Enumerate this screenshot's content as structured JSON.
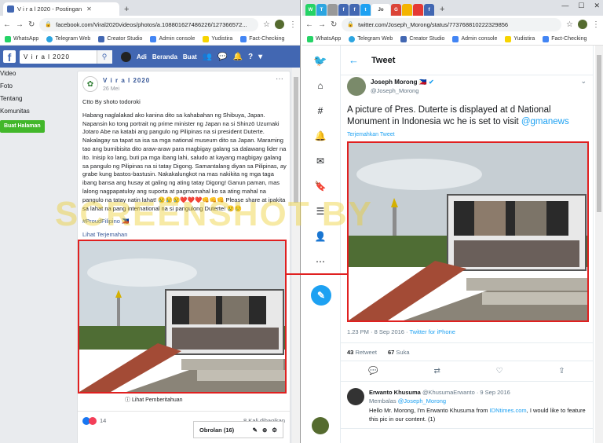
{
  "left_window": {
    "tab_title": "V i r a l 2020 - Postingan",
    "url": "facebook.com/Viral2020videos/photos/a.108801627486226/127366572...",
    "bookmarks": [
      "WhatsApp",
      "Telegram Web",
      "Creator Studio",
      "Admin console",
      "Yudistira",
      "Fact-Checking"
    ],
    "fb": {
      "search_value": "V i r a l 2020",
      "nav": {
        "user": "Adi",
        "home": "Beranda",
        "create": "Buat"
      },
      "left_nav": [
        "Video",
        "Foto",
        "Tentang",
        "Komunitas"
      ],
      "create_page_button": "Buat Halaman",
      "post": {
        "page_name": "V i r a l 2020",
        "date": "26 Mei",
        "line1": "Ctto By shoto todoroki",
        "body": "Habang naglalakad ako kanina dito sa kahabahan ng Shibuya, Japan. Napansin ko tong portrait ng prime minister ng Japan na si Shinzō Uzumaki Jotaro Abe na katabi ang pangulo ng Pilipinas na si president Duterte. Nakalagay sa tapat sa isa sa mga national museum dito sa Japan. Maraming tao ang bumibisita dito araw-araw para magbigay galang sa dalawang lider na ito. Inisip ko lang, buti pa mga ibang lahi, saludo at kayang magbigay galang sa pangulo ng Pilipinas na si tatay Digong. Samantalang diyan sa Pilipinas, ay grabe kung bastos-bastusin. Nakakalungkot na mas nakikita ng mga taga ibang bansa ang husay at galing ng ating tatay Digong! Ganun paman, mas lalong nagpapatuloy ang suporta at pagmamahal ko sa ating mahal na pangulo na tatay natin lahat! 😢😢😢❤️❤️❤️👊👊👊 Please share at ipakita sa lahat na pang international na si pangulong Duterte! 😢😢",
        "hashtag": "#ProudFilipino 🇵🇭",
        "see_translation": "Lihat Terjemahan",
        "show_notification": "Lihat Pemberitahuan",
        "reaction_count": "14",
        "shares": "8 Kali dibagikan"
      },
      "chat": {
        "label": "Obrolan (16)"
      }
    }
  },
  "right_window": {
    "active_tab_label": "Jo",
    "url": "twitter.com/Joseph_Morong/status/773768810222329856",
    "bookmarks": [
      "WhatsApp",
      "Telegram Web",
      "Creator Studio",
      "Admin console",
      "Yudistira",
      "Fact-Checking"
    ],
    "tweet": {
      "header": "Tweet",
      "author_name": "Joseph Morong 🇵🇭",
      "author_handle": "@Joseph_Morong",
      "text": "A picture of Pres. Duterte is displayed at d National Monument in Indonesia wc he is set to visit ",
      "mention": "@gmanews",
      "translate": "Terjemahkan Tweet",
      "time": "1.23 PM · 8 Sep 2016 · ",
      "source": "Twitter for iPhone",
      "retweets": "43",
      "retweets_label": "Retweet",
      "likes": "67",
      "likes_label": "Suka"
    },
    "reply": {
      "name": "Erwanto Khusuma",
      "handle_date": "@KhusumaErwanto · 9 Sep 2016",
      "replying": "Membalas ",
      "replying_to": "@Joseph_Morong",
      "text_a": "Hello Mr. Morong, I'm Erwanto Khusuma from ",
      "text_link": "IDNtimes.com",
      "text_b": ", I would like to feature this pic in our content. (1)"
    }
  },
  "watermark": "SCREENSHOT BY"
}
